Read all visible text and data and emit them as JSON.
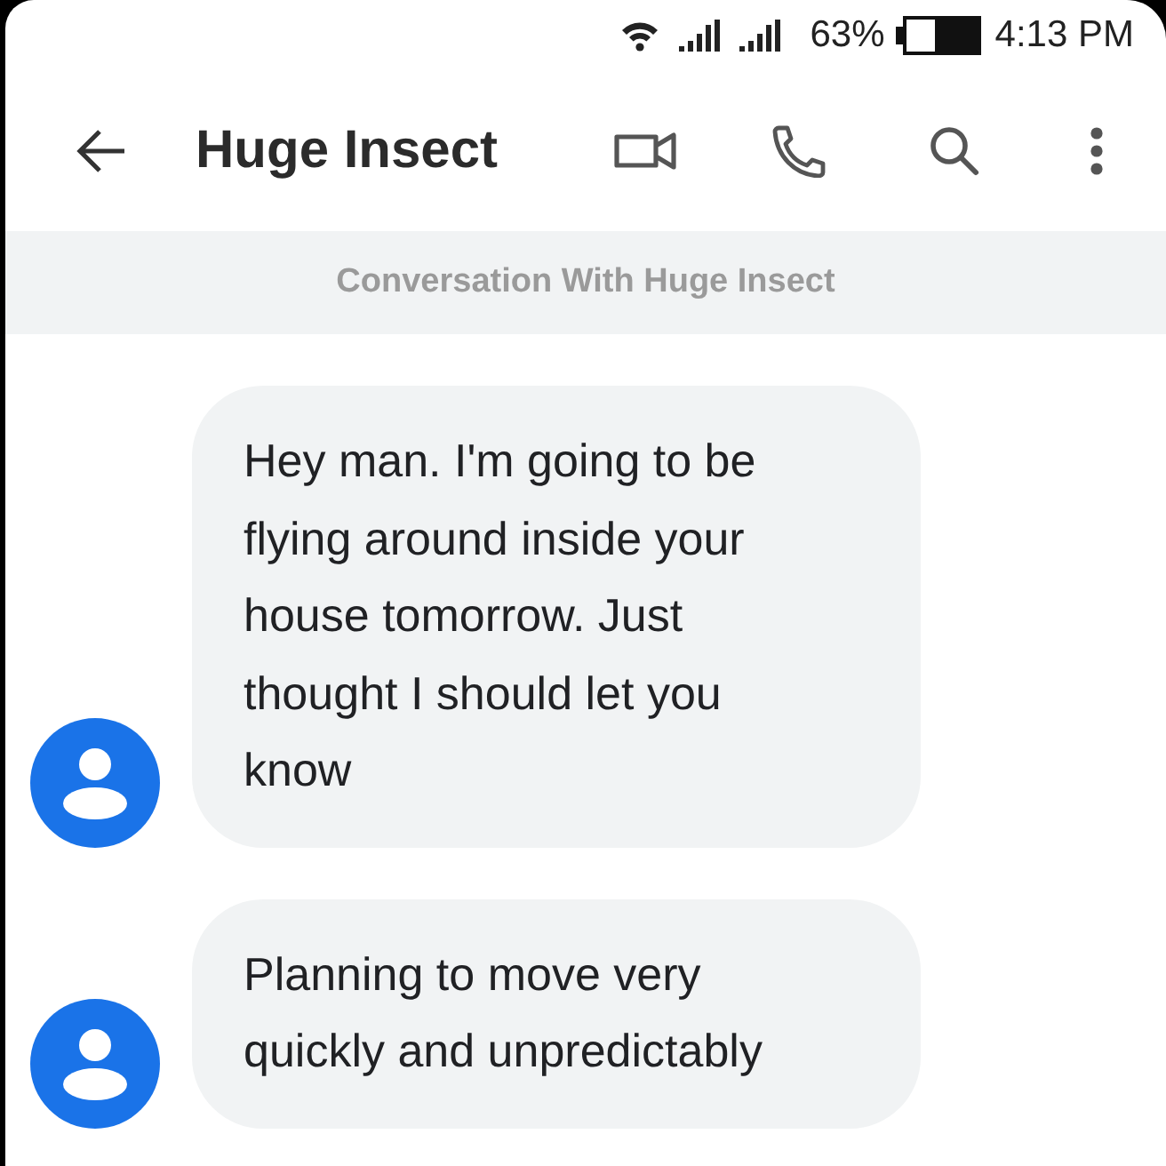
{
  "status_bar": {
    "battery": "63%",
    "time": "4:13 PM"
  },
  "header": {
    "title": "Huge Insect"
  },
  "banner": {
    "text": "Conversation With Huge Insect"
  },
  "messages": [
    {
      "text": "Hey man. I'm going to be flying around inside your house tomorrow. Just thought I should let you know"
    },
    {
      "text": "Planning to move very quickly and unpredictably"
    }
  ]
}
